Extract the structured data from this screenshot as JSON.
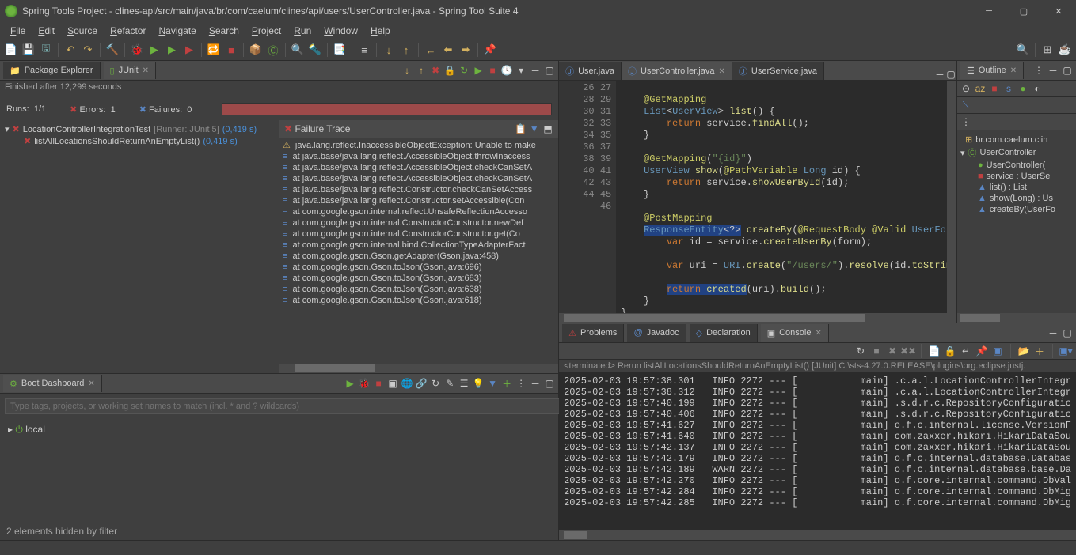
{
  "title": "Spring Tools Project - clines-api/src/main/java/br/com/caelum/clines/api/users/UserController.java - Spring Tool Suite 4",
  "menu": [
    "File",
    "Edit",
    "Source",
    "Refactor",
    "Navigate",
    "Search",
    "Project",
    "Run",
    "Window",
    "Help"
  ],
  "junit": {
    "tab_pe": "Package Explorer",
    "tab_junit": "JUnit",
    "finished": "Finished after 12,299 seconds",
    "runs_lbl": "Runs:",
    "runs_val": "1/1",
    "errors_lbl": "Errors:",
    "errors_val": "1",
    "failures_lbl": "Failures:",
    "failures_val": "0",
    "test_root": "LocationControllerIntegrationTest",
    "test_runner": "[Runner: JUnit 5]",
    "test_time": "(0,419 s)",
    "test_child": "listAllLocationsShouldReturnAnEmptyList()",
    "test_child_time": "(0,419 s)"
  },
  "failure": {
    "header": "Failure Trace",
    "rows": [
      "java.lang.reflect.InaccessibleObjectException: Unable to make",
      "at java.base/java.lang.reflect.AccessibleObject.throwInaccess",
      "at java.base/java.lang.reflect.AccessibleObject.checkCanSetA",
      "at java.base/java.lang.reflect.AccessibleObject.checkCanSetA",
      "at java.base/java.lang.reflect.Constructor.checkCanSetAccess",
      "at java.base/java.lang.reflect.Constructor.setAccessible(Con",
      "at com.google.gson.internal.reflect.UnsafeReflectionAccesso",
      "at com.google.gson.internal.ConstructorConstructor.newDef",
      "at com.google.gson.internal.ConstructorConstructor.get(Co",
      "at com.google.gson.internal.bind.CollectionTypeAdapterFact",
      "at com.google.gson.Gson.getAdapter(Gson.java:458)",
      "at com.google.gson.Gson.toJson(Gson.java:696)",
      "at com.google.gson.Gson.toJson(Gson.java:683)",
      "at com.google.gson.Gson.toJson(Gson.java:638)",
      "at com.google.gson.Gson.toJson(Gson.java:618)"
    ]
  },
  "boot": {
    "title": "Boot Dashboard",
    "placeholder": "Type tags, projects, or working set names to match (incl. * and ? wildcards)",
    "node": "local",
    "hidden": "2 elements hidden by filter"
  },
  "editor_tabs": {
    "t1": "User.java",
    "t2": "UserController.java",
    "t3": "UserService.java"
  },
  "editor": {
    "lines": [
      {
        "n": 26,
        "html": ""
      },
      {
        "n": 27,
        "html": "    <span class='anno'>@GetMapping</span>"
      },
      {
        "n": 28,
        "html": "    <span class='type'>List</span>&lt;<span class='type'>UserView</span>&gt; <span class='mth'>list</span>() {"
      },
      {
        "n": 29,
        "html": "        <span class='kw'>return</span> service.<span class='mth'>findAll</span>();"
      },
      {
        "n": 30,
        "html": "    }"
      },
      {
        "n": 31,
        "html": ""
      },
      {
        "n": 32,
        "html": "    <span class='anno'>@GetMapping</span>(<span class='str'>\"{id}\"</span>)"
      },
      {
        "n": 33,
        "html": "    <span class='type'>UserView</span> <span class='mth'>show</span>(<span class='anno'>@PathVariable</span> <span class='type'>Long</span> id) {"
      },
      {
        "n": 34,
        "html": "        <span class='kw'>return</span> service.<span class='mth'>showUserById</span>(id);"
      },
      {
        "n": 35,
        "html": "    }"
      },
      {
        "n": 36,
        "html": ""
      },
      {
        "n": 37,
        "html": "    <span class='anno'>@PostMapping</span>"
      },
      {
        "n": 38,
        "html": "    <span class='sel'><span class='type'>ResponseEntity</span>&lt;?&gt;</span> <span class='mth'>createBy</span>(<span class='anno'>@RequestBody</span> <span class='anno'>@Valid</span> <span class='type'>UserFor</span>"
      },
      {
        "n": 39,
        "html": "        <span class='kw'>var</span> id = service.<span class='mth'>createUserBy</span>(form);"
      },
      {
        "n": 40,
        "html": ""
      },
      {
        "n": 41,
        "html": "        <span class='kw'>var</span> uri = <span class='type'>URI</span>.<span class='mth'>create</span>(<span class='str'>\"/users/\"</span>).<span class='mth'>resolve</span>(id.<span class='mth'>toStrin</span>"
      },
      {
        "n": 42,
        "html": ""
      },
      {
        "n": 43,
        "html": "        <span class='sel'><span class='kw'>return</span> <span class='mth'>created</span></span>(uri).<span class='mth'>build</span>();"
      },
      {
        "n": 44,
        "html": "    }"
      },
      {
        "n": 45,
        "html": "}"
      },
      {
        "n": 46,
        "html": ""
      }
    ]
  },
  "bottom_tabs": [
    "Problems",
    "Javadoc",
    "Declaration",
    "Console"
  ],
  "console": {
    "title": "<terminated> Rerun listAllLocationsShouldReturnAnEmptyList() [JUnit] C:\\sts-4.27.0.RELEASE\\plugins\\org.eclipse.justj.",
    "body": "2025-02-03 19:57:38.301   INFO 2272 --- [           main] .c.a.l.LocationControllerIntegr\n2025-02-03 19:57:38.312   INFO 2272 --- [           main] .c.a.l.LocationControllerIntegr\n2025-02-03 19:57:40.199   INFO 2272 --- [           main] .s.d.r.c.RepositoryConfiguratic\n2025-02-03 19:57:40.406   INFO 2272 --- [           main] .s.d.r.c.RepositoryConfiguratic\n2025-02-03 19:57:41.627   INFO 2272 --- [           main] o.f.c.internal.license.VersionF\n2025-02-03 19:57:41.640   INFO 2272 --- [           main] com.zaxxer.hikari.HikariDataSou\n2025-02-03 19:57:42.137   INFO 2272 --- [           main] com.zaxxer.hikari.HikariDataSou\n2025-02-03 19:57:42.179   INFO 2272 --- [           main] o.f.c.internal.database.Databas\n2025-02-03 19:57:42.189   WARN 2272 --- [           main] o.f.c.internal.database.base.Da\n2025-02-03 19:57:42.270   INFO 2272 --- [           main] o.f.core.internal.command.DbVal\n2025-02-03 19:57:42.284   INFO 2272 --- [           main] o.f.core.internal.command.DbMig\n2025-02-03 19:57:42.285   INFO 2272 --- [           main] o.f.core.internal.command.DbMig"
  },
  "outline": {
    "title": "Outline",
    "pkg": "br.com.caelum.clin",
    "cls": "UserController",
    "items": [
      {
        "ico": "●",
        "col": "#6db33f",
        "txt": "UserController("
      },
      {
        "ico": "■",
        "col": "#c04040",
        "txt": "service : UserSe"
      },
      {
        "ico": "▲",
        "col": "#5a86c4",
        "txt": "list() : List<User"
      },
      {
        "ico": "▲",
        "col": "#5a86c4",
        "txt": "show(Long) : Us"
      },
      {
        "ico": "▲",
        "col": "#5a86c4",
        "txt": "createBy(UserFo"
      }
    ]
  }
}
